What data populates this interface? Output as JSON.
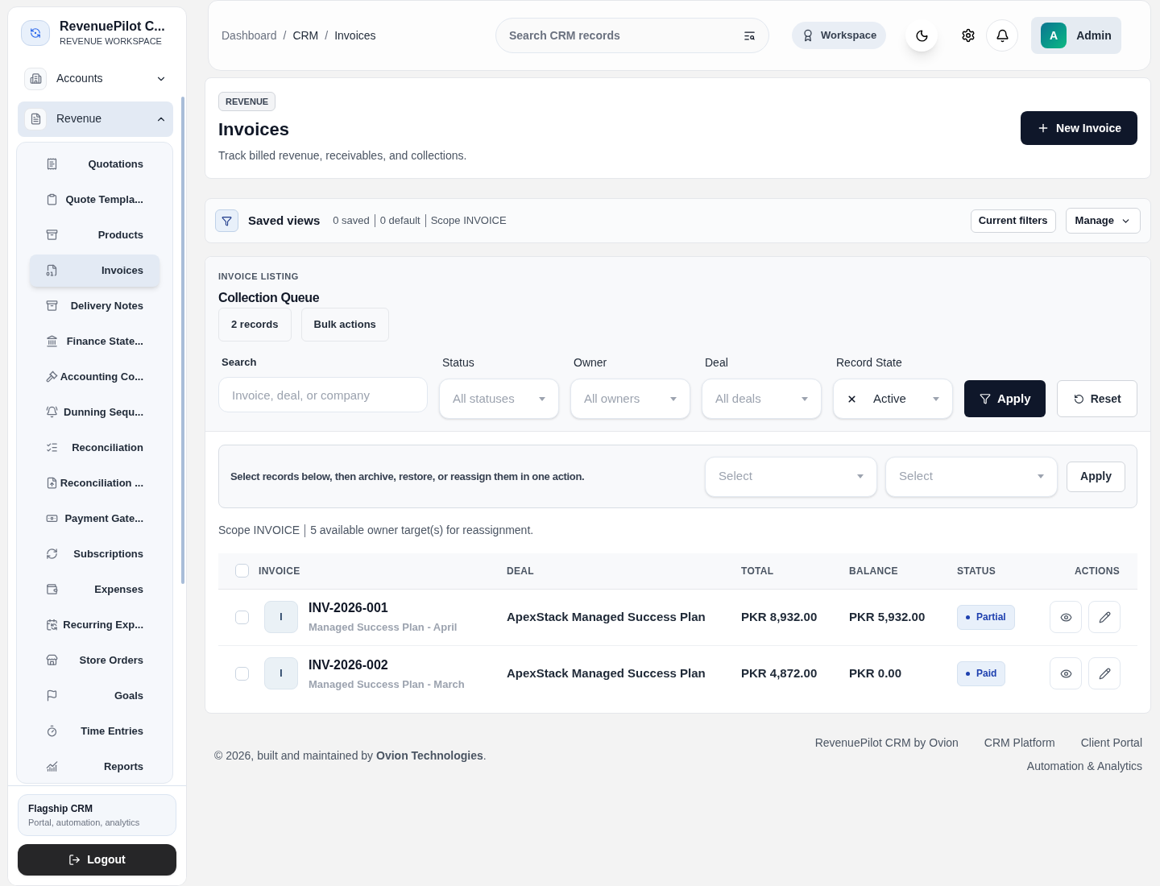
{
  "brand": {
    "name": "RevenuePilot C...",
    "subtitle": "REVENUE WORKSPACE"
  },
  "nav": [
    {
      "label": "Accounts",
      "expanded": false,
      "selected": false
    },
    {
      "label": "Revenue",
      "expanded": true,
      "selected": true,
      "children": [
        {
          "label": "Quotations",
          "selected": false
        },
        {
          "label": "Quote Templa...",
          "selected": false
        },
        {
          "label": "Products",
          "selected": false
        },
        {
          "label": "Invoices",
          "selected": true
        },
        {
          "label": "Delivery Notes",
          "selected": false
        },
        {
          "label": "Finance State...",
          "selected": false
        },
        {
          "label": "Accounting Co...",
          "selected": false
        },
        {
          "label": "Dunning Sequ...",
          "selected": false
        },
        {
          "label": "Reconciliation",
          "selected": false
        },
        {
          "label": "Reconciliation ...",
          "selected": false
        },
        {
          "label": "Payment Gate...",
          "selected": false
        },
        {
          "label": "Subscriptions",
          "selected": false
        },
        {
          "label": "Expenses",
          "selected": false
        },
        {
          "label": "Recurring Exp...",
          "selected": false
        },
        {
          "label": "Store Orders",
          "selected": false
        },
        {
          "label": "Goals",
          "selected": false
        },
        {
          "label": "Time Entries",
          "selected": false
        },
        {
          "label": "Reports",
          "selected": false
        }
      ]
    }
  ],
  "sidebar_footer": {
    "title": "Flagship CRM",
    "subtitle": "Portal, automation, analytics",
    "logout": "Logout"
  },
  "breadcrumb": {
    "separator": "/",
    "items": [
      "Dashboard",
      "CRM",
      "Invoices"
    ]
  },
  "topbar": {
    "search_placeholder": "Search CRM records",
    "workspace": "Workspace",
    "avatar": "A",
    "user": "Admin"
  },
  "page_header": {
    "badge": "REVENUE",
    "title": "Invoices",
    "subtitle": "Track billed revenue, receivables, and collections.",
    "new_button": "New Invoice"
  },
  "saved_views": {
    "title": "Saved views",
    "meta": [
      "0 saved",
      "0 default",
      "Scope INVOICE"
    ],
    "current_filters": "Current filters",
    "manage": "Manage"
  },
  "listing": {
    "eyebrow": "INVOICE LISTING",
    "title": "Collection Queue",
    "chips": [
      "2 records",
      "Bulk actions"
    ]
  },
  "filters": {
    "search_label": "Search",
    "search_placeholder": "Invoice, deal, or company",
    "selects": [
      {
        "label": "Status",
        "placeholder": "All statuses"
      },
      {
        "label": "Owner",
        "placeholder": "All owners"
      },
      {
        "label": "Deal",
        "placeholder": "All deals"
      },
      {
        "label": "Record State",
        "value": "Active"
      }
    ],
    "apply": "Apply",
    "reset": "Reset"
  },
  "bulk": {
    "text": "Select records below, then archive, restore, or reassign them in one action.",
    "selects": [
      {
        "placeholder": "Select"
      },
      {
        "placeholder": "Select"
      }
    ],
    "apply": "Apply"
  },
  "scope_note": [
    "Scope INVOICE",
    "5 available owner target(s) for reassignment."
  ],
  "table": {
    "select_all_checked": false,
    "columns": [
      "INVOICE",
      "DEAL",
      "TOTAL",
      "BALANCE",
      "STATUS",
      "ACTIONS"
    ],
    "rows": [
      {
        "checked": false,
        "initial": "I",
        "number": "INV-2026-001",
        "plan": "Managed Success Plan - April",
        "deal": "ApexStack Managed Success Plan",
        "total": "PKR 8,932.00",
        "balance": "PKR 5,932.00",
        "status": "Partial"
      },
      {
        "checked": false,
        "initial": "I",
        "number": "INV-2026-002",
        "plan": "Managed Success Plan - March",
        "deal": "ApexStack Managed Success Plan",
        "total": "PKR 4,872.00",
        "balance": "PKR 0.00",
        "status": "Paid"
      }
    ]
  },
  "footer": {
    "copyright": "© 2026, built and maintained by **Ovion Technologies**.",
    "links": [
      "RevenuePilot CRM by Ovion",
      "CRM Platform",
      "Client Portal",
      "Automation & Analytics"
    ]
  }
}
